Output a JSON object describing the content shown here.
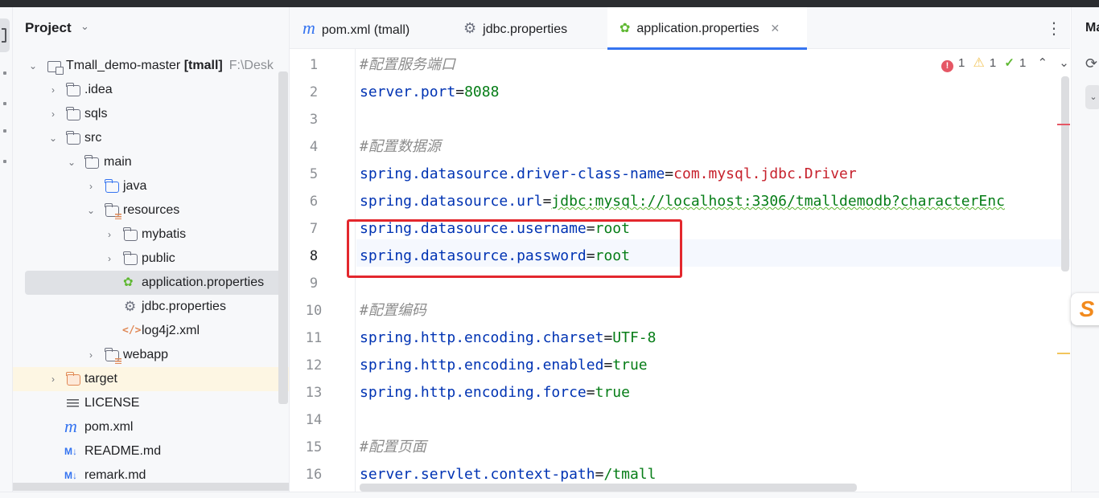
{
  "project_panel": {
    "title": "Project",
    "tree": [
      {
        "label": "Tmall_demo-master",
        "suffix": "[tmall]",
        "path": "F:\\Desk"
      },
      {
        "label": ".idea"
      },
      {
        "label": "sqls"
      },
      {
        "label": "src"
      },
      {
        "label": "main"
      },
      {
        "label": "java"
      },
      {
        "label": "resources"
      },
      {
        "label": "mybatis"
      },
      {
        "label": "public"
      },
      {
        "label": "application.properties"
      },
      {
        "label": "jdbc.properties"
      },
      {
        "label": "log4j2.xml"
      },
      {
        "label": "webapp"
      },
      {
        "label": "target"
      },
      {
        "label": "LICENSE"
      },
      {
        "label": "pom.xml"
      },
      {
        "label": "README.md"
      },
      {
        "label": "remark.md"
      }
    ]
  },
  "tabs": [
    {
      "label": "pom.xml (tmall)",
      "icon": "maven-icon"
    },
    {
      "label": "jdbc.properties",
      "icon": "gear-icon"
    },
    {
      "label": "application.properties",
      "icon": "spring-leaf-icon",
      "active": true
    }
  ],
  "inspections": {
    "errors": "1",
    "warnings": "1",
    "ok": "1"
  },
  "line_numbers": [
    "1",
    "2",
    "3",
    "4",
    "5",
    "6",
    "7",
    "8",
    "9",
    "10",
    "11",
    "12",
    "13",
    "14",
    "15",
    "16"
  ],
  "code_lines": [
    {
      "type": "comment",
      "text": "#配置服务端口"
    },
    {
      "type": "kv",
      "key": "server.port",
      "value": "8088",
      "color": "green"
    },
    {
      "type": "blank"
    },
    {
      "type": "comment",
      "text": "#配置数据源"
    },
    {
      "type": "kv",
      "key": "spring.datasource.driver-class-name",
      "value": "com.mysql.jdbc.Driver",
      "color": "red"
    },
    {
      "type": "kv",
      "key": "spring.datasource.url",
      "value": "jdbc:mysql://localhost:3306/tmalldemodb?characterEnc",
      "color": "green"
    },
    {
      "type": "kv",
      "key": "spring.datasource.username",
      "value": "root",
      "color": "green"
    },
    {
      "type": "kv",
      "key": "spring.datasource.password",
      "value": "root",
      "color": "green"
    },
    {
      "type": "blank"
    },
    {
      "type": "comment",
      "text": "#配置编码"
    },
    {
      "type": "kv",
      "key": "spring.http.encoding.charset",
      "value": "UTF-8",
      "color": "green"
    },
    {
      "type": "kv",
      "key": "spring.http.encoding.enabled",
      "value": "true",
      "color": "green"
    },
    {
      "type": "kv",
      "key": "spring.http.encoding.force",
      "value": "true",
      "color": "green"
    },
    {
      "type": "blank"
    },
    {
      "type": "comment",
      "text": "#配置页面"
    },
    {
      "type": "kv",
      "key": "server.servlet.context-path",
      "value": "/tmall",
      "color": "green"
    }
  ],
  "right_panel": {
    "title": "Ma"
  },
  "colors": {
    "accent": "#3574f0",
    "key": "#0033b3",
    "value": "#067d17",
    "value_red": "#c7222d",
    "comment": "#8c8c8c",
    "highlight_box": "#e3272d"
  }
}
